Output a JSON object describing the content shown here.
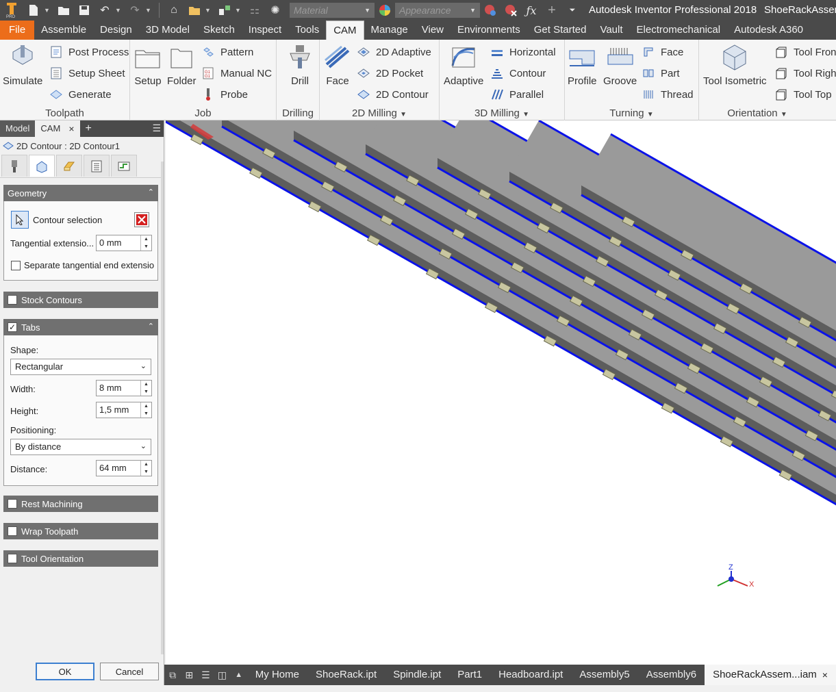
{
  "titlebar": {
    "app_title": "Autodesk Inventor Professional 2018",
    "doc_title": "ShoeRackAssem",
    "material_placeholder": "Material",
    "appearance_placeholder": "Appearance"
  },
  "ribbon_tabs": [
    "File",
    "Assemble",
    "Design",
    "3D Model",
    "Sketch",
    "Inspect",
    "Tools",
    "CAM",
    "Manage",
    "View",
    "Environments",
    "Get Started",
    "Vault",
    "Electromechanical",
    "Autodesk A360"
  ],
  "active_ribbon_tab": "CAM",
  "ribbon": {
    "toolpath": {
      "label": "Toolpath",
      "simulate": "Simulate",
      "post_process": "Post Process",
      "setup_sheet": "Setup Sheet",
      "generate": "Generate"
    },
    "job": {
      "label": "Job",
      "setup": "Setup",
      "folder": "Folder",
      "pattern": "Pattern",
      "manual_nc": "Manual NC",
      "probe": "Probe"
    },
    "drilling": {
      "label": "Drilling",
      "drill": "Drill"
    },
    "milling2d": {
      "label": "2D Milling",
      "face": "Face",
      "adaptive": "2D Adaptive",
      "pocket": "2D Pocket",
      "contour": "2D Contour"
    },
    "milling3d": {
      "label": "3D Milling",
      "adaptive": "Adaptive",
      "horizontal": "Horizontal",
      "contour": "Contour",
      "parallel": "Parallel"
    },
    "turning": {
      "label": "Turning",
      "profile": "Profile",
      "groove": "Groove",
      "face": "Face",
      "part": "Part",
      "thread": "Thread"
    },
    "orientation": {
      "label": "Orientation",
      "tool_isometric": "Tool Isometric",
      "tool_front": "Tool Front",
      "tool_right": "Tool Right",
      "tool_top": "Tool Top"
    }
  },
  "panel": {
    "tabs": [
      "Model",
      "CAM"
    ],
    "active_tab": "CAM",
    "operation_title": "2D Contour : 2D Contour1",
    "geometry": {
      "header": "Geometry",
      "contour_selection": "Contour selection",
      "tangential_label": "Tangential extensio...",
      "tangential_value": "0 mm",
      "separate_label": "Separate tangential end extensio"
    },
    "stock_contours": "Stock Contours",
    "tabs_section": {
      "header": "Tabs",
      "shape_label": "Shape:",
      "shape_value": "Rectangular",
      "width_label": "Width:",
      "width_value": "8 mm",
      "height_label": "Height:",
      "height_value": "1,5 mm",
      "positioning_label": "Positioning:",
      "positioning_value": "By distance",
      "distance_label": "Distance:",
      "distance_value": "64 mm"
    },
    "rest_machining": "Rest Machining",
    "wrap_toolpath": "Wrap Toolpath",
    "tool_orientation": "Tool Orientation",
    "ok": "OK",
    "cancel": "Cancel"
  },
  "document_tabs": [
    "My Home",
    "ShoeRack.ipt",
    "Spindle.ipt",
    "Part1",
    "Headboard.ipt",
    "Assembly5",
    "Assembly6",
    "ShoeRackAssem...iam"
  ],
  "active_document_tab": "ShoeRackAssem...iam",
  "axis_labels": {
    "z": "Z",
    "x": "X"
  },
  "colors": {
    "file_tab": "#ec6d1a",
    "toolpath_blue": "#0a12e8",
    "slat_top": "#9a9a9a",
    "slat_side": "#5d5d5d",
    "tab_marker": "#c8c6a0"
  }
}
